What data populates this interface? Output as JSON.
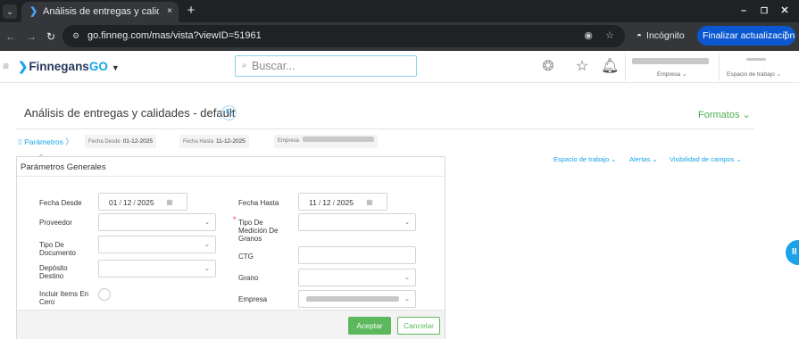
{
  "browser": {
    "tab_title": "Análisis de entregas y calid",
    "tab_close": "×",
    "new_tab": "+",
    "url": "go.finneg.com/mas/vista?viewID=51961",
    "incognito_label": "Incógnito",
    "update_label": "Finalizar actualización",
    "window_controls": [
      "minimize",
      "restore",
      "close"
    ]
  },
  "header": {
    "logo_text": "Finnegans",
    "logo_suffix": "GO",
    "search_placeholder": "Buscar...",
    "company_label": "Empresa",
    "workspace_label": "Espacio de trabajo",
    "icons": [
      "brain-icon",
      "star-icon",
      "bell-icon"
    ]
  },
  "page": {
    "title": "Análisis de entregas y calidades - default",
    "formatos_label": "Formatos",
    "parameters_link": "Parámetros",
    "chips": [
      {
        "label": "Fecha Desde",
        "value": "01-12-2025"
      },
      {
        "label": "Fecha Hasta",
        "value": "11-12-2025"
      },
      {
        "label": "Empresa",
        "value": ""
      }
    ],
    "right_links": [
      "Espacio de trabajo",
      "Alertas",
      "Visibilidad de campos"
    ]
  },
  "panel": {
    "title": "Parámetros Generales",
    "fields": {
      "fecha_desde": {
        "label": "Fecha Desde",
        "day": "01",
        "month": "12",
        "year": "2025"
      },
      "fecha_hasta": {
        "label": "Fecha Hasta",
        "day": "11",
        "month": "12",
        "year": "2025"
      },
      "proveedor": {
        "label": "Proveedor",
        "value": ""
      },
      "tipo_medicion": {
        "label": "Tipo De Medición De Granos",
        "value": "",
        "required": true
      },
      "tipo_documento": {
        "label": "Tipo De Documento",
        "value": ""
      },
      "ctg": {
        "label": "CTG",
        "value": ""
      },
      "deposito_destino": {
        "label": "Depósito Destino",
        "value": ""
      },
      "grano": {
        "label": "Grano",
        "value": ""
      },
      "incluir_items": {
        "label": "Incluir Items En Cero",
        "checked": false
      },
      "empresa": {
        "label": "Empresa",
        "value": ""
      }
    },
    "accept_label": "Aceptar",
    "cancel_label": "Cancelar"
  },
  "colors": {
    "brand_blue": "#1aa3e8",
    "accept_green": "#5cb85c",
    "chrome_dark": "#202124",
    "update_blue": "#0b57d0"
  }
}
